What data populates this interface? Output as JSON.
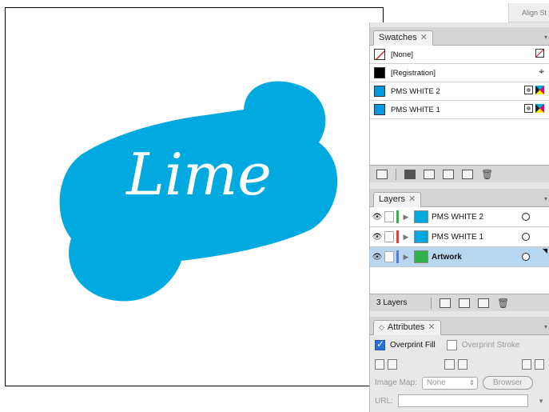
{
  "artwork": {
    "text": "Lime",
    "shape_color": "#00a9e0",
    "text_color": "#ffffff"
  },
  "top_panel_tab": "Align St",
  "swatches": {
    "tab_label": "Swatches",
    "items": [
      {
        "name": "[None]",
        "chip": "none"
      },
      {
        "name": "[Registration]",
        "chip": "#000000"
      },
      {
        "name": "PMS WHITE 2",
        "chip": "#0099e0"
      },
      {
        "name": "PMS WHITE 1",
        "chip": "#0099e0"
      }
    ]
  },
  "layers": {
    "tab_label": "Layers",
    "items": [
      {
        "name": "PMS WHITE 2",
        "color": "#33b44a",
        "selected": false
      },
      {
        "name": "PMS WHITE 1",
        "color": "#e8413b",
        "selected": false
      },
      {
        "name": "Artwork",
        "color": "#4f7fd9",
        "selected": true
      }
    ],
    "count_label": "3 Layers"
  },
  "attributes": {
    "tab_label": "Attributes",
    "overprint_fill_label": "Overprint Fill",
    "overprint_fill_checked": true,
    "overprint_stroke_label": "Overprint Stroke",
    "overprint_stroke_checked": false,
    "image_map_label": "Image Map:",
    "image_map_value": "None",
    "browser_label": "Browser",
    "url_label": "URL:"
  }
}
